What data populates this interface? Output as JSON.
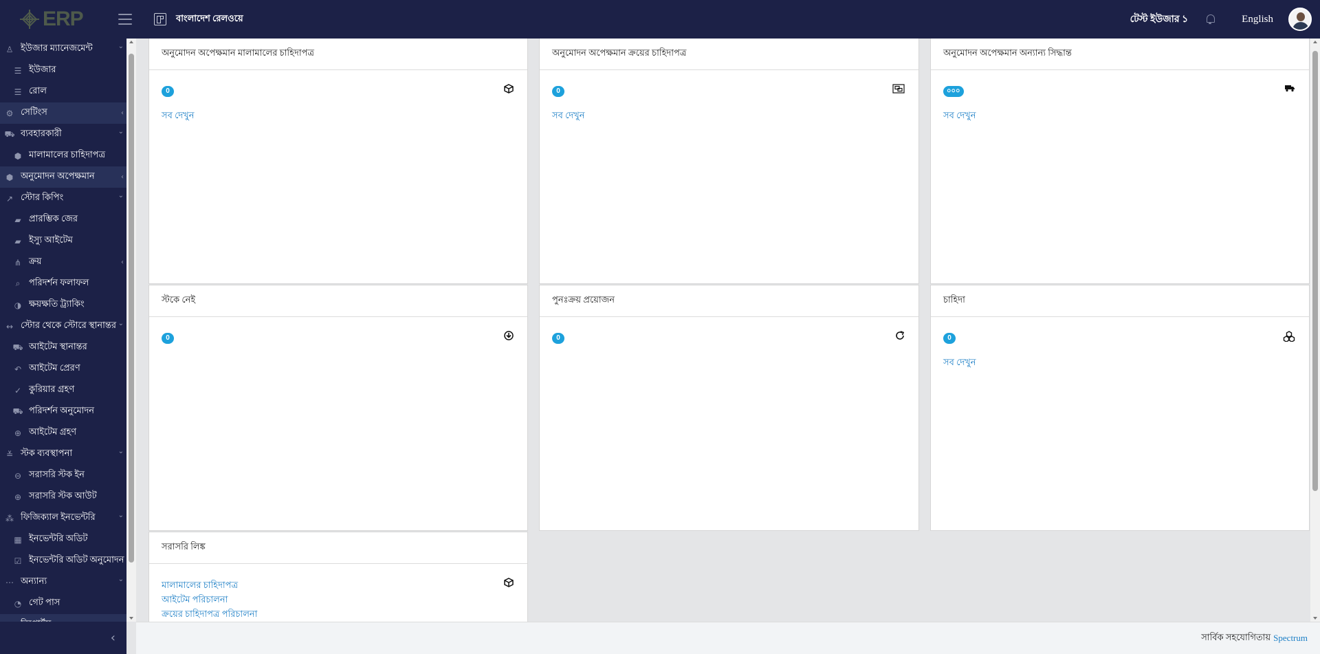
{
  "topbar": {
    "logo_text": "ERP",
    "org_name": "বাংলাদেশ রেলওয়ে",
    "user_name": "টেস্ট ইউজার ১",
    "language": "English"
  },
  "sidebar": {
    "items": [
      {
        "label": "ইউজার ম্যানেজমেন্ট",
        "icon": "user-icon",
        "level": "parent",
        "chevron": "down",
        "active": false
      },
      {
        "label": "ইউজার",
        "icon": "list-icon",
        "level": "child",
        "active": false
      },
      {
        "label": "রোল",
        "icon": "list-icon",
        "level": "child",
        "active": false
      },
      {
        "label": "সেটিংস",
        "icon": "cogs-icon",
        "level": "parent",
        "chevron": "left",
        "active": true
      },
      {
        "label": "ব্যবহারকারী",
        "icon": "cart-icon",
        "level": "parent",
        "chevron": "down",
        "active": false
      },
      {
        "label": "মালামালের চাহিদাপত্র",
        "icon": "box-icon",
        "level": "child",
        "active": false
      },
      {
        "label": "অনুমোদন অপেক্ষমান",
        "icon": "box-icon",
        "level": "parent",
        "chevron": "left",
        "active": true
      },
      {
        "label": "স্টোর কিপিং",
        "icon": "chart-line-icon",
        "level": "parent",
        "chevron": "down",
        "active": false
      },
      {
        "label": "প্রারম্ভিক জের",
        "icon": "folder-open-icon",
        "level": "child",
        "active": false
      },
      {
        "label": "ইস্যু আইটেম",
        "icon": "folder-open-icon",
        "level": "child",
        "active": false
      },
      {
        "label": "ক্রয়",
        "icon": "sitemap-icon",
        "level": "child",
        "chevron": "left",
        "active": false
      },
      {
        "label": "পরিদর্শন ফলাফল",
        "icon": "search-icon",
        "level": "child",
        "active": false
      },
      {
        "label": "ক্ষয়ক্ষতি ট্র্যাকিং",
        "icon": "half-circle-icon",
        "level": "child",
        "active": false
      },
      {
        "label": "স্টোর থেকে স্টোরে স্থানান্তর",
        "icon": "arrows-h-icon",
        "level": "parent",
        "chevron": "down",
        "active": false
      },
      {
        "label": "আইটেম স্থানান্তর",
        "icon": "truck-icon",
        "level": "child",
        "active": false
      },
      {
        "label": "আইটেম প্রেরণ",
        "icon": "reply-icon",
        "level": "child",
        "active": false
      },
      {
        "label": "কুরিয়ার গ্রহণ",
        "icon": "check-icon",
        "level": "child",
        "active": false
      },
      {
        "label": "পরিদর্শন অনুমোদন",
        "icon": "cart-arrow-icon",
        "level": "child",
        "active": false
      },
      {
        "label": "আইটেম গ্রহণ",
        "icon": "download-circle-icon",
        "level": "child",
        "active": false
      },
      {
        "label": "স্টক ব্যবস্থাপনা",
        "icon": "sliders-icon",
        "level": "parent",
        "chevron": "down",
        "active": false
      },
      {
        "label": "সরাসরি স্টক ইন",
        "icon": "arrow-circle-down-icon",
        "level": "child",
        "active": false
      },
      {
        "label": "সরাসরি স্টক আউট",
        "icon": "arrow-circle-up-icon",
        "level": "child",
        "active": false
      },
      {
        "label": "ফিজিক্যাল ইনভেন্টরি",
        "icon": "cubes-icon",
        "level": "parent",
        "chevron": "down",
        "active": false
      },
      {
        "label": "ইনভেন্টরি অডিট",
        "icon": "film-icon",
        "level": "child",
        "active": false
      },
      {
        "label": "ইনভেন্টরি অডিট অনুমোদন",
        "icon": "check-square-icon",
        "level": "child",
        "active": false
      },
      {
        "label": "অন্যান্য",
        "icon": "ellipsis-icon",
        "level": "parent",
        "chevron": "down",
        "active": false
      },
      {
        "label": "গেট পাস",
        "icon": "dashboard-icon",
        "level": "child",
        "active": false
      },
      {
        "label": "রিপোর্টস",
        "icon": "book-icon",
        "level": "parent",
        "chevron": "left",
        "active": true
      }
    ]
  },
  "cards": {
    "pending_requisition": {
      "title": "অনুমোদন অপেক্ষমান মালামালের চাহিদাপত্র",
      "count": "0",
      "see_all": "সব দেখুন",
      "icon": "cube-icon"
    },
    "pending_purchase": {
      "title": "অনুমোদন অপেক্ষমান ক্রয়ের চাহিদাপত্র",
      "count": "0",
      "see_all": "সব দেখুন",
      "icon": "object-group-icon"
    },
    "pending_other": {
      "title": "অনুমোদন অপেক্ষমান অন্যান্য সিদ্ধান্ত",
      "count": "০০০",
      "see_all": "সব দেখুন",
      "icon": "truck-icon"
    },
    "out_of_stock": {
      "title": "স্টকে নেই",
      "count": "0",
      "icon": "arrow-circle-down-icon"
    },
    "reorder": {
      "title": "পুনঃক্রয় প্রয়োজন",
      "count": "0",
      "icon": "refresh-icon"
    },
    "demand": {
      "title": "চাহিদা",
      "count": "0",
      "see_all": "সব দেখুন",
      "icon": "cubes-icon"
    },
    "quick_links": {
      "title": "সরাসরি লিঙ্ক",
      "icon": "cube-icon",
      "links": [
        "মালামালের চাহিদাপত্র",
        "আইটেম পরিচালনা",
        "ক্রয়ের চাহিদাপত্র পরিচালনা"
      ]
    }
  },
  "footer": {
    "credit_text": "সার্বিক সহযোগিতায়",
    "credit_link": "Spectrum"
  },
  "colors": {
    "sidebar_bg": "#1c2147",
    "active_item_bg": "#283159",
    "badge": "#1da1dc",
    "link": "#1d7fc6",
    "main_bg": "#e4e5e7"
  }
}
